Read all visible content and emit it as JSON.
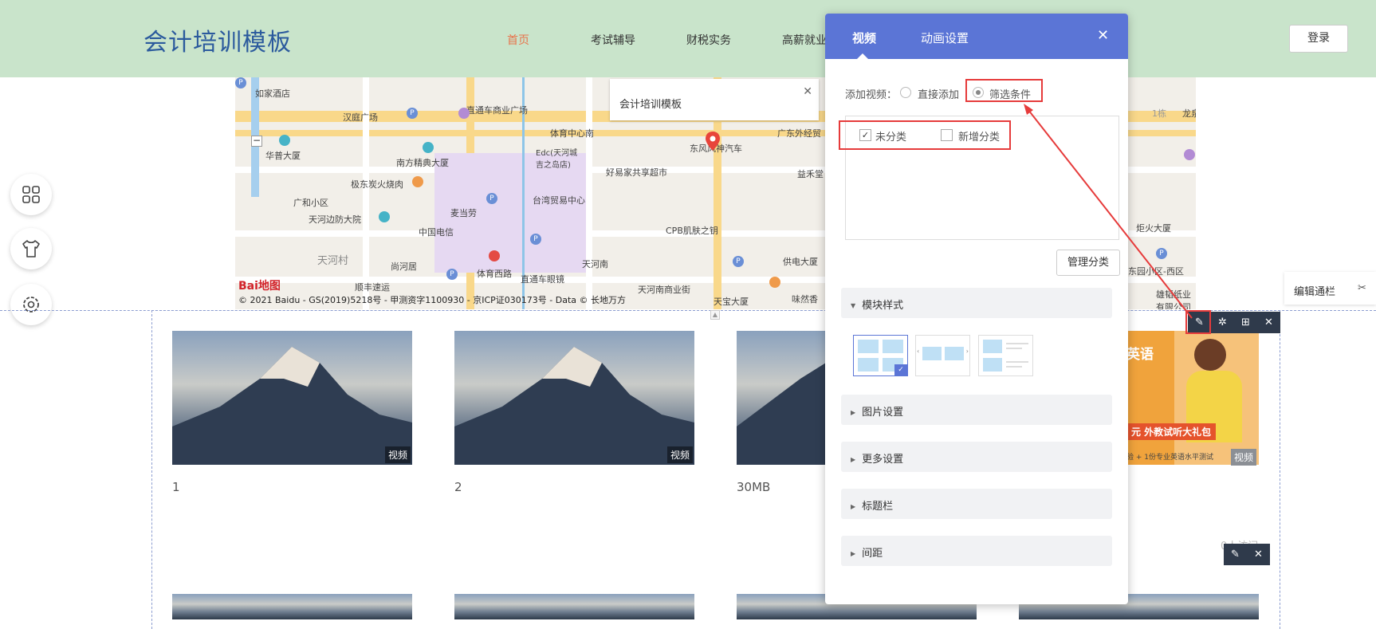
{
  "header": {
    "site_title": "会计培训模板",
    "nav": [
      "首页",
      "考试辅导",
      "财税实务",
      "高薪就业"
    ],
    "login": "登录"
  },
  "map": {
    "popup_title": "会计培训模板",
    "copyright": "© 2021 Baidu - GS(2019)5218号 - 甲测资字1100930 - 京ICP证030173号 - Data © 长地万方",
    "logo": "Bai地图",
    "pois": [
      "如家酒店",
      "汉庭广场",
      "直通车商业广场",
      "体育中心南",
      "广东外经贸",
      "东风风神汽车",
      "华普大厦",
      "南方精典大厦",
      "Edc(天河城吉之岛店)",
      "好易家共享超市",
      "益禾堂",
      "极东炭火烧肉",
      "广和小区",
      "台湾贸易中心",
      "麦当劳",
      "天河边防大院",
      "中国电信",
      "CPB肌肤之钥",
      "天河村",
      "尚河居",
      "体育西路",
      "天河南",
      "供电大厦",
      "顺丰速运",
      "直通车眼镜",
      "天河南商业街",
      "天宝大厦",
      "味然香",
      "炬火大厦",
      "东园小区-西区",
      "雄韬纸业有限公司",
      "1栋",
      "龙泉"
    ]
  },
  "left_tools": [
    "apps-icon",
    "shirt-icon",
    "settings-icon"
  ],
  "cards": [
    {
      "title": "1",
      "tag": "视频"
    },
    {
      "title": "2",
      "tag": "视频"
    },
    {
      "title": "30MB",
      "tag": "视频"
    }
  ],
  "ad": {
    "headline": "英语",
    "promo": "元 外教试听大礼包",
    "sub": "验 + 1份专业英语水平测试",
    "tag": "视频",
    "visits": "0人访问"
  },
  "edit_bar": {
    "label": "编辑通栏"
  },
  "panel": {
    "tabs": [
      "视频",
      "动画设置"
    ],
    "add_video_label": "添加视频：",
    "radio_direct": "直接添加",
    "radio_filter": "筛选条件",
    "cat_uncategorized": "未分类",
    "cat_new": "新增分类",
    "manage_btn": "管理分类",
    "sections": [
      "模块样式",
      "图片设置",
      "更多设置",
      "标题栏",
      "间距"
    ]
  },
  "colors": {
    "header_bg": "#c9e4cb",
    "panel_header": "#5b75d6",
    "nav_active": "#e8734b",
    "highlight_red": "#e63b3b"
  }
}
